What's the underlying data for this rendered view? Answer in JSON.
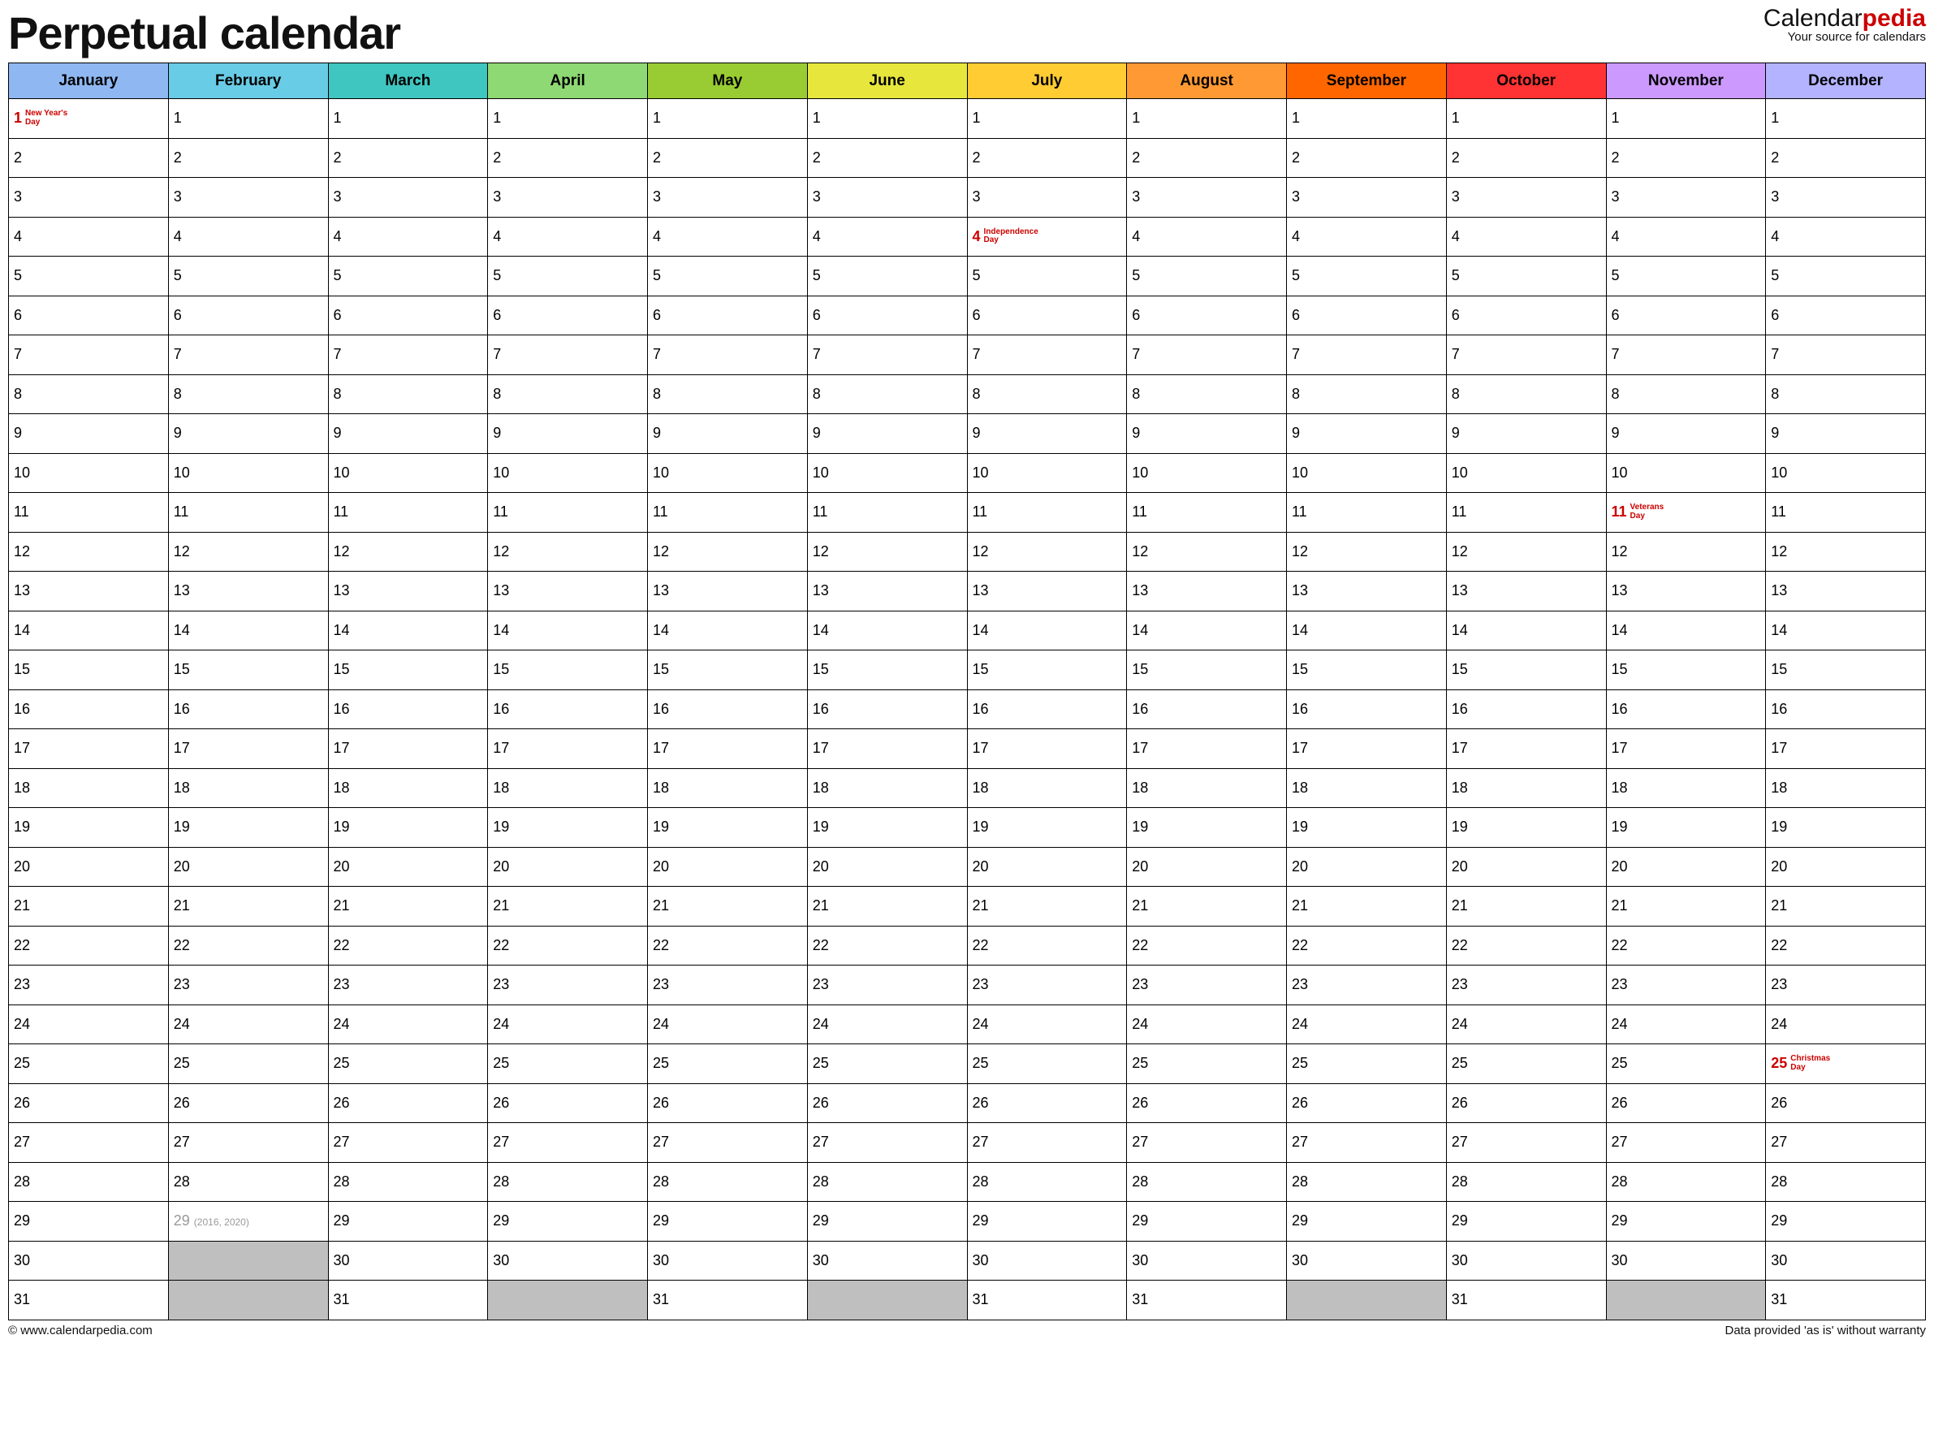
{
  "title": "Perpetual calendar",
  "logo": {
    "brand_left": "Calendar",
    "brand_right": "pedia",
    "tagline": "Your source for calendars"
  },
  "months": [
    {
      "name": "January",
      "color": "#8fb8f2",
      "days": 31
    },
    {
      "name": "February",
      "color": "#69cce6",
      "days": 28
    },
    {
      "name": "March",
      "color": "#3fc6c0",
      "days": 31
    },
    {
      "name": "April",
      "color": "#8ed973",
      "days": 30
    },
    {
      "name": "May",
      "color": "#99cc33",
      "days": 31
    },
    {
      "name": "June",
      "color": "#e6e63c",
      "days": 30
    },
    {
      "name": "July",
      "color": "#ffcc33",
      "days": 31
    },
    {
      "name": "August",
      "color": "#ff9933",
      "days": 31
    },
    {
      "name": "September",
      "color": "#ff6600",
      "days": 30
    },
    {
      "name": "October",
      "color": "#ff3333",
      "days": 31
    },
    {
      "name": "November",
      "color": "#cc99ff",
      "days": 30
    },
    {
      "name": "December",
      "color": "#b3b3ff",
      "days": 31
    }
  ],
  "max_rows": 31,
  "holidays": [
    {
      "month": 0,
      "day": 1,
      "label": "New Year's Day"
    },
    {
      "month": 6,
      "day": 4,
      "label": "Independence Day"
    },
    {
      "month": 10,
      "day": 11,
      "label": "Veterans Day"
    },
    {
      "month": 11,
      "day": 25,
      "label": "Christmas Day"
    }
  ],
  "leap_cell": {
    "month": 1,
    "day": 29,
    "note": "(2016, 2020)"
  },
  "footer": {
    "left": "© www.calendarpedia.com",
    "right": "Data provided 'as is' without warranty"
  }
}
